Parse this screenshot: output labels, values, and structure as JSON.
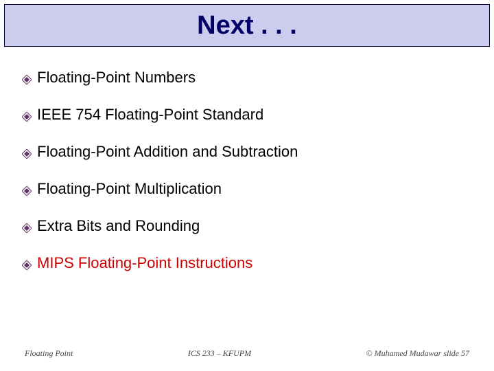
{
  "title": "Next . . .",
  "bullets": [
    {
      "text": "Floating-Point Numbers",
      "highlight": false
    },
    {
      "text": "IEEE 754 Floating-Point Standard",
      "highlight": false
    },
    {
      "text": "Floating-Point Addition and Subtraction",
      "highlight": false
    },
    {
      "text": "Floating-Point Multiplication",
      "highlight": false
    },
    {
      "text": "Extra Bits and Rounding",
      "highlight": false
    },
    {
      "text": "MIPS Floating-Point Instructions",
      "highlight": true
    }
  ],
  "footer": {
    "left": "Floating Point",
    "center": "ICS 233 – KFUPM",
    "right": "© Muhamed Mudawar   slide 57"
  },
  "colors": {
    "title_bg": "#ccccee",
    "title_fg": "#000066",
    "highlight": "#cc0000",
    "bullet_icon": "#663366"
  }
}
